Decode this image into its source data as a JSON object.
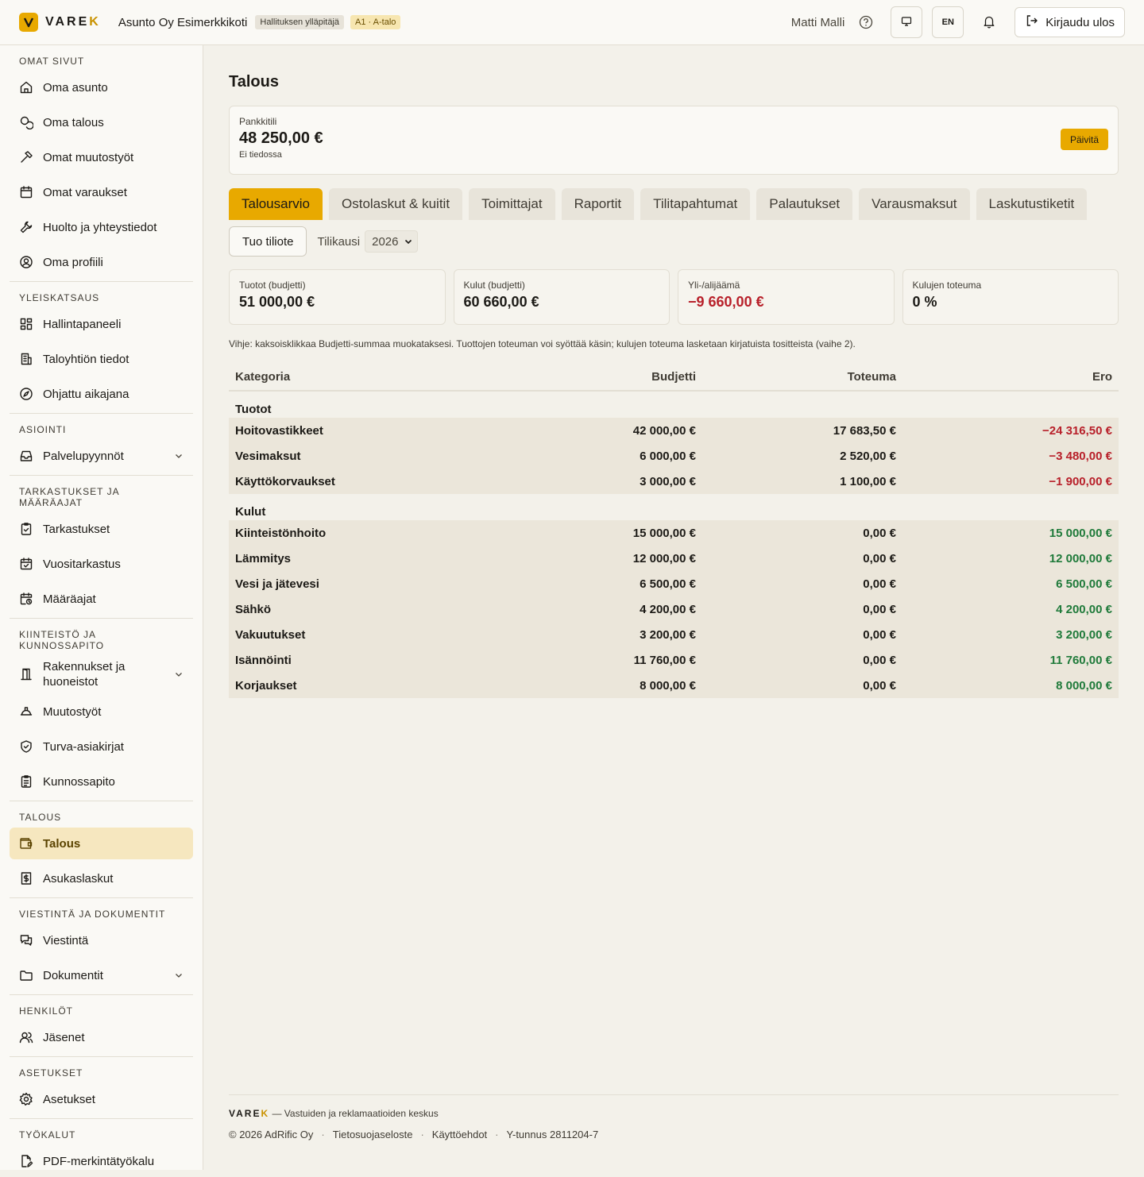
{
  "brand": {
    "name_main": "VARE",
    "name_accent": "K"
  },
  "header": {
    "org_name": "Asunto Oy Esimerkkikoti",
    "role_badge": "Hallituksen ylläpitäjä",
    "apartment_badge": "A1 · A-talo",
    "user_name": "Matti Malli",
    "language": "EN",
    "logout_label": "Kirjaudu ulos"
  },
  "sidebar": {
    "sections": [
      {
        "title": "OMAT SIVUT",
        "items": [
          {
            "label": "Oma asunto",
            "icon": "home-icon"
          },
          {
            "label": "Oma talous",
            "icon": "coins-icon"
          },
          {
            "label": "Omat muutostyöt",
            "icon": "hammer-icon"
          },
          {
            "label": "Omat varaukset",
            "icon": "calendar-icon"
          },
          {
            "label": "Huolto ja yhteystiedot",
            "icon": "wrench-icon"
          },
          {
            "label": "Oma profiili",
            "icon": "user-circle-icon"
          }
        ]
      },
      {
        "title": "YLEISKATSAUS",
        "items": [
          {
            "label": "Hallintapaneeli",
            "icon": "dashboard-icon"
          },
          {
            "label": "Taloyhtiön tiedot",
            "icon": "building-icon"
          },
          {
            "label": "Ohjattu aikajana",
            "icon": "compass-icon"
          }
        ]
      },
      {
        "title": "ASIOINTI",
        "items": [
          {
            "label": "Palvelupyynnöt",
            "icon": "inbox-icon",
            "expandable": true
          }
        ]
      },
      {
        "title": "TARKASTUKSET JA MÄÄRÄAJAT",
        "items": [
          {
            "label": "Tarkastukset",
            "icon": "clipboard-check-icon"
          },
          {
            "label": "Vuositarkastus",
            "icon": "calendar-check-icon"
          },
          {
            "label": "Määräajat",
            "icon": "calendar-clock-icon"
          }
        ]
      },
      {
        "title": "KIINTEISTÖ JA KUNNOSSAPITO",
        "items": [
          {
            "label": "Rakennukset ja huoneistot",
            "icon": "door-icon",
            "expandable": true,
            "tall": true
          },
          {
            "label": "Muutostyöt",
            "icon": "hard-hat-icon"
          },
          {
            "label": "Turva-asiakirjat",
            "icon": "shield-check-icon"
          },
          {
            "label": "Kunnossapito",
            "icon": "clipboard-list-icon"
          }
        ]
      },
      {
        "title": "TALOUS",
        "items": [
          {
            "label": "Talous",
            "icon": "wallet-icon",
            "active": true
          },
          {
            "label": "Asukaslaskut",
            "icon": "receipt-dollar-icon"
          }
        ]
      },
      {
        "title": "VIESTINTÄ JA DOKUMENTIT",
        "items": [
          {
            "label": "Viestintä",
            "icon": "messages-icon"
          },
          {
            "label": "Dokumentit",
            "icon": "folder-icon",
            "expandable": true
          }
        ]
      },
      {
        "title": "HENKILÖT",
        "items": [
          {
            "label": "Jäsenet",
            "icon": "users-icon"
          }
        ]
      },
      {
        "title": "ASETUKSET",
        "items": [
          {
            "label": "Asetukset",
            "icon": "gear-icon"
          }
        ]
      },
      {
        "title": "TYÖKALUT",
        "items": [
          {
            "label": "PDF-merkintätyökalu",
            "icon": "file-pen-icon"
          }
        ]
      }
    ]
  },
  "page": {
    "title": "Talous",
    "bank": {
      "label": "Pankkitili",
      "amount": "48 250,00 €",
      "sub": "Ei tiedossa",
      "refresh_label": "Päivitä"
    },
    "tabs": [
      {
        "label": "Talousarvio",
        "active": true
      },
      {
        "label": "Ostolaskut & kuitit"
      },
      {
        "label": "Toimittajat"
      },
      {
        "label": "Raportit"
      },
      {
        "label": "Tilitapahtumat"
      },
      {
        "label": "Palautukset"
      },
      {
        "label": "Varausmaksut"
      },
      {
        "label": "Laskutustiketit"
      }
    ],
    "import_label": "Tuo tiliote",
    "fiscal_year_label": "Tilikausi",
    "fiscal_year_value": "2026",
    "stats": [
      {
        "label": "Tuotot (budjetti)",
        "value": "51 000,00 €",
        "negative": false
      },
      {
        "label": "Kulut (budjetti)",
        "value": "60 660,00 €",
        "negative": false
      },
      {
        "label": "Yli-/alijäämä",
        "value": "−9 660,00 €",
        "negative": true
      },
      {
        "label": "Kulujen toteuma",
        "value": "0 %",
        "negative": false
      }
    ],
    "hint": "Vihje: kaksoisklikkaa Budjetti-summaa muokataksesi. Tuottojen toteuman voi syöttää käsin; kulujen toteuma lasketaan kirjatuista tositteista (vaihe 2).",
    "table": {
      "headers": {
        "category": "Kategoria",
        "budget": "Budjetti",
        "actual": "Toteuma",
        "diff": "Ero"
      },
      "groups": [
        {
          "name": "Tuotot",
          "rows": [
            {
              "category": "Hoitovastikkeet",
              "budget": "42 000,00 €",
              "actual": "17 683,50 €",
              "diff": "−24 316,50 €",
              "sign": "neg"
            },
            {
              "category": "Vesimaksut",
              "budget": "6 000,00 €",
              "actual": "2 520,00 €",
              "diff": "−3 480,00 €",
              "sign": "neg"
            },
            {
              "category": "Käyttökorvaukset",
              "budget": "3 000,00 €",
              "actual": "1 100,00 €",
              "diff": "−1 900,00 €",
              "sign": "neg"
            }
          ]
        },
        {
          "name": "Kulut",
          "rows": [
            {
              "category": "Kiinteistönhoito",
              "budget": "15 000,00 €",
              "actual": "0,00 €",
              "diff": "15 000,00 €",
              "sign": "pos"
            },
            {
              "category": "Lämmitys",
              "budget": "12 000,00 €",
              "actual": "0,00 €",
              "diff": "12 000,00 €",
              "sign": "pos"
            },
            {
              "category": "Vesi ja jätevesi",
              "budget": "6 500,00 €",
              "actual": "0,00 €",
              "diff": "6 500,00 €",
              "sign": "pos"
            },
            {
              "category": "Sähkö",
              "budget": "4 200,00 €",
              "actual": "0,00 €",
              "diff": "4 200,00 €",
              "sign": "pos"
            },
            {
              "category": "Vakuutukset",
              "budget": "3 200,00 €",
              "actual": "0,00 €",
              "diff": "3 200,00 €",
              "sign": "pos"
            },
            {
              "category": "Isännöinti",
              "budget": "11 760,00 €",
              "actual": "0,00 €",
              "diff": "11 760,00 €",
              "sign": "pos"
            },
            {
              "category": "Korjaukset",
              "budget": "8 000,00 €",
              "actual": "0,00 €",
              "diff": "8 000,00 €",
              "sign": "pos"
            }
          ]
        }
      ]
    }
  },
  "footer": {
    "tagline": "— Vastuiden ja reklamaatioiden keskus",
    "copyright": "© 2026 AdRific Oy",
    "privacy": "Tietosuojaseloste",
    "terms": "Käyttöehdot",
    "business_id": "Y-tunnus 2811204-7"
  },
  "colors": {
    "accent": "#e8a900",
    "negative": "#b8202a",
    "positive": "#1f7a3a",
    "active_nav": "#f6e7bf"
  }
}
